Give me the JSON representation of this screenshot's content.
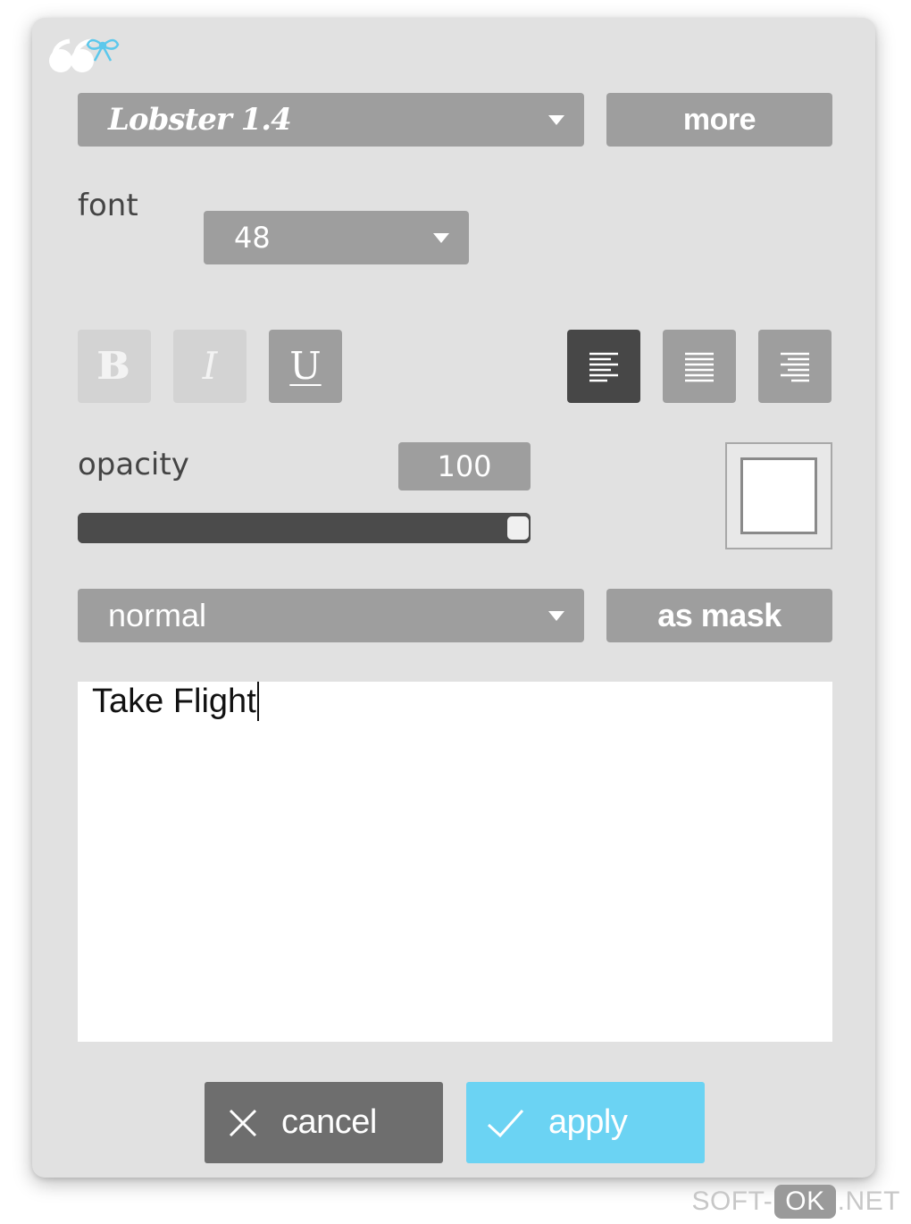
{
  "font_family_select": {
    "value": "Lobster 1.4"
  },
  "more_button": {
    "label": "more"
  },
  "font_label": "font",
  "font_size_select": {
    "value": "48"
  },
  "style_buttons": {
    "bold": {
      "glyph": "B",
      "state": "disabled"
    },
    "italic": {
      "glyph": "I",
      "state": "disabled"
    },
    "underline": {
      "glyph": "U",
      "state": "enabled"
    }
  },
  "align_buttons": {
    "left": {
      "state": "active"
    },
    "center": {
      "state": "enabled"
    },
    "right": {
      "state": "enabled"
    }
  },
  "opacity": {
    "label": "opacity",
    "value": "100",
    "level": 1.0
  },
  "color_swatch": {
    "color": "#ffffff"
  },
  "blend_select": {
    "value": "normal"
  },
  "mask_button": {
    "label": "as mask"
  },
  "text_input": {
    "value": "Take Flight"
  },
  "actions": {
    "cancel": {
      "label": "cancel",
      "icon": "close-icon"
    },
    "apply": {
      "label": "apply",
      "icon": "check-icon"
    }
  },
  "watermark": {
    "prefix": "SOFT-",
    "badge": "OK",
    "suffix": ".NET"
  },
  "colors": {
    "panel": "#e1e1e1",
    "control": "#9e9e9e",
    "active": "#474747",
    "cancel": "#6e6e6e",
    "apply": "#6bd3f3"
  }
}
